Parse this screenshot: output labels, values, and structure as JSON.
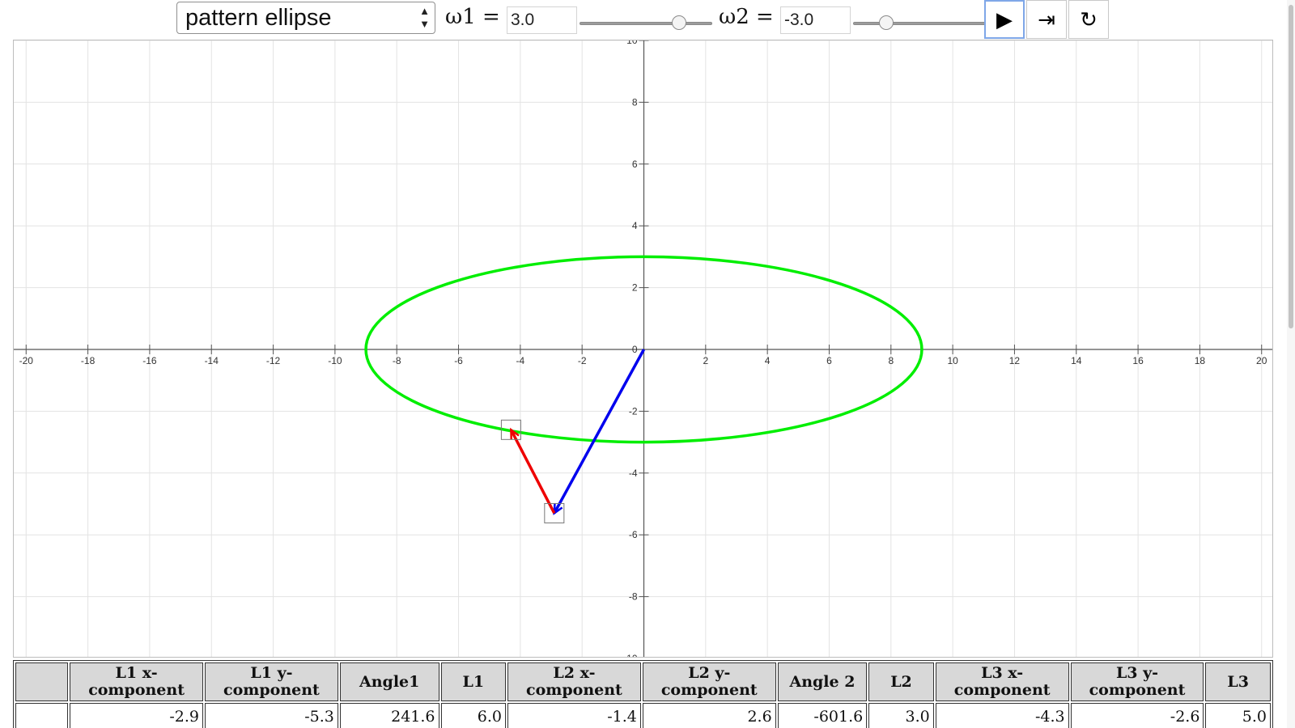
{
  "toolbar": {
    "pattern_select": {
      "value": "pattern ellipse"
    },
    "omega1": {
      "label": "ω1  =",
      "value": "3.0",
      "slider_fraction": 0.78
    },
    "omega2": {
      "label": "ω2  =",
      "value": "-3.0",
      "slider_fraction": 0.22
    },
    "buttons": {
      "play": "▶",
      "step": "⇥",
      "reset": "↻"
    }
  },
  "plot": {
    "x_range": [
      -20.4,
      20.4
    ],
    "y_range": [
      -10,
      10
    ],
    "x_ticks": [
      "-20",
      "-18",
      "-16",
      "-14",
      "-12",
      "-10",
      "-8",
      "-6",
      "-4",
      "-2",
      "0",
      "2",
      "4",
      "6",
      "8",
      "10",
      "12",
      "14",
      "16",
      "18",
      "20"
    ],
    "y_ticks": [
      "-10",
      "-8",
      "-6",
      "-4",
      "-2",
      "2",
      "4",
      "6",
      "8",
      "10"
    ],
    "origin_label": "0",
    "ellipse": {
      "center": [
        0,
        0
      ],
      "rx": 9.0,
      "ry": 3.0,
      "color": "#00ee00"
    },
    "vector_blue": {
      "from": [
        0,
        0
      ],
      "to": [
        -2.9,
        -5.3
      ],
      "color": "#0000ee"
    },
    "vector_red": {
      "from": [
        -2.9,
        -5.3
      ],
      "to": [
        -4.3,
        -2.6
      ],
      "color": "#ee0000"
    }
  },
  "table": {
    "headers": [
      "",
      "L1 x-\ncomponent",
      "L1 y-\ncomponent",
      "Angle1",
      "L1",
      "L2 x-\ncomponent",
      "L2 y-\ncomponent",
      "Angle 2",
      "L2",
      "L3 x-\ncomponent",
      "L3 y-\ncomponent",
      "L3"
    ],
    "rows": [
      [
        "",
        "-2.9",
        "-5.3",
        "241.6",
        "6.0",
        "-1.4",
        "2.6",
        "-601.6",
        "3.0",
        "-4.3",
        "-2.6",
        "5.0"
      ]
    ]
  }
}
